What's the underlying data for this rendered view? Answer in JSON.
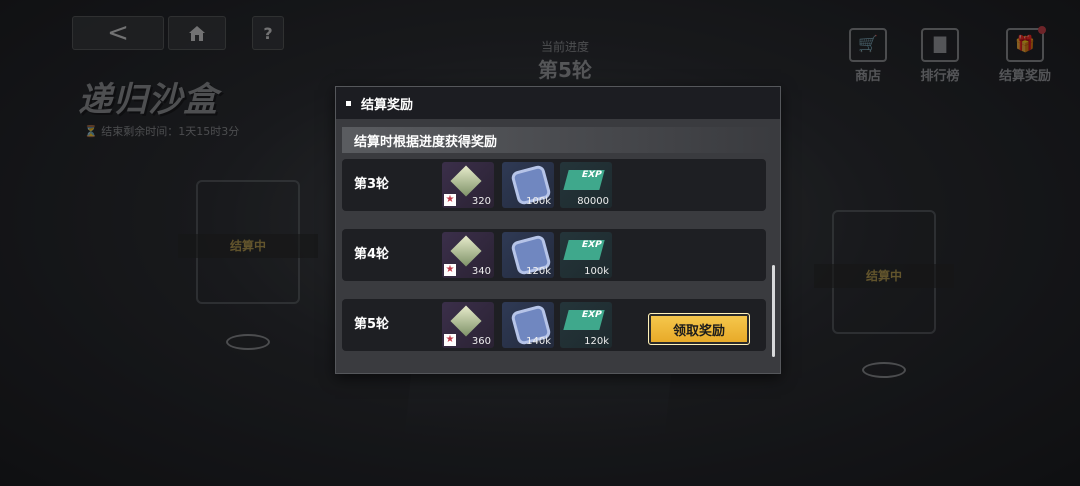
{
  "nav": {
    "back_label": "<",
    "help_label": "?"
  },
  "progress": {
    "label": "当前进度",
    "value": "第5轮"
  },
  "event": {
    "title": "递归沙盒",
    "time_left": "结束剩余时间：1天15时3分"
  },
  "side_menu": [
    {
      "label": "商店",
      "icon": "shop-icon"
    },
    {
      "label": "排行榜",
      "icon": "rank-icon"
    },
    {
      "label": "结算奖励",
      "icon": "gift-icon"
    }
  ],
  "pods": {
    "left_label": "结算中",
    "right_label": "结算中"
  },
  "modal": {
    "title": "结算奖励",
    "subtitle": "结算时根据进度获得奖励",
    "rows": [
      {
        "label": "第3轮",
        "items": [
          "320",
          "100k",
          "80000"
        ],
        "claim": null
      },
      {
        "label": "第4轮",
        "items": [
          "340",
          "120k",
          "100k"
        ],
        "claim": null
      },
      {
        "label": "第5轮",
        "items": [
          "360",
          "140k",
          "120k"
        ],
        "claim": "领取奖励"
      }
    ]
  },
  "colors": {
    "accent": "#f6c94f",
    "panel": "#3a3b3f",
    "header": "#1c1d22"
  }
}
